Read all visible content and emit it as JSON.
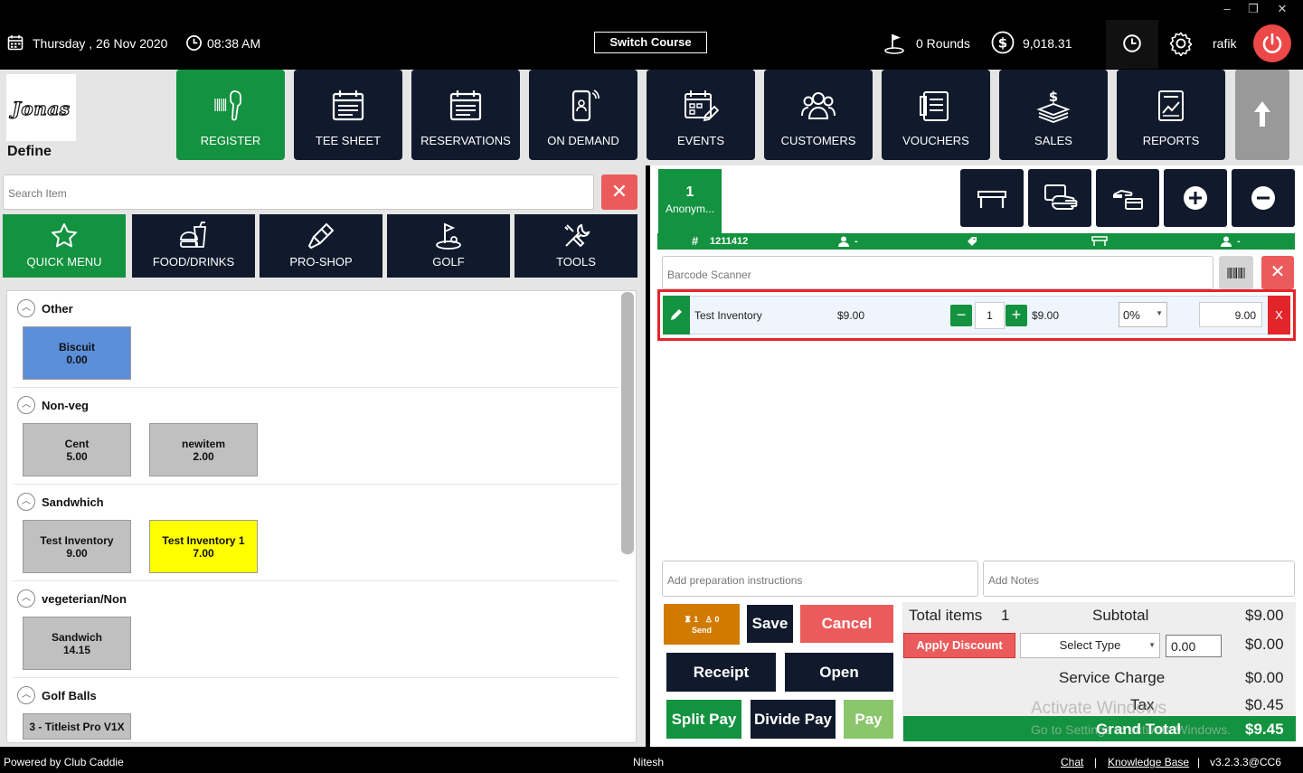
{
  "window_controls": {
    "minimize": "–",
    "restore": "❐",
    "close": "✕"
  },
  "topbar": {
    "date": "Thursday ,  26 Nov 2020",
    "time": "08:38 AM",
    "switch_course": "Switch Course",
    "rounds": "0 Rounds",
    "balance": "9,018.31",
    "user": "rafik"
  },
  "logo": {
    "text": "Jonas",
    "define": "Define"
  },
  "nav": [
    {
      "label": "REGISTER",
      "icon": "barcode-scanner-icon"
    },
    {
      "label": "TEE SHEET",
      "icon": "calendar-icon"
    },
    {
      "label": "RESERVATIONS",
      "icon": "calendar-icon"
    },
    {
      "label": "ON DEMAND",
      "icon": "mobile-icon"
    },
    {
      "label": "EVENTS",
      "icon": "calendar-edit-icon"
    },
    {
      "label": "CUSTOMERS",
      "icon": "users-icon"
    },
    {
      "label": "VOUCHERS",
      "icon": "voucher-icon"
    },
    {
      "label": "SALES",
      "icon": "cash-icon"
    },
    {
      "label": "REPORTS",
      "icon": "report-icon"
    }
  ],
  "search": {
    "placeholder": "Search Item"
  },
  "categories": [
    {
      "label": "QUICK MENU"
    },
    {
      "label": "FOOD/DRINKS"
    },
    {
      "label": "PRO-SHOP"
    },
    {
      "label": "GOLF"
    },
    {
      "label": "TOOLS"
    }
  ],
  "groups": [
    {
      "name": "Other",
      "items": [
        {
          "name": "Biscuit",
          "price": "0.00",
          "color": "#5b8fd9"
        }
      ]
    },
    {
      "name": "Non-veg",
      "items": [
        {
          "name": "Cent",
          "price": "5.00",
          "color": "#c0c0c0"
        },
        {
          "name": "newitem",
          "price": "2.00",
          "color": "#c0c0c0"
        }
      ]
    },
    {
      "name": "Sandwhich",
      "items": [
        {
          "name": "Test Inventory",
          "price": "9.00",
          "color": "#c0c0c0"
        },
        {
          "name": "Test Inventory 1",
          "price": "7.00",
          "color": "#ffff00"
        }
      ]
    },
    {
      "name": "vegeterian/Non",
      "items": [
        {
          "name": "Sandwich",
          "price": "14.15",
          "color": "#c0c0c0"
        }
      ]
    },
    {
      "name": "Golf Balls",
      "items": [
        {
          "name": "3 - Titleist Pro V1X",
          "price": "",
          "color": "#c0c0c0"
        }
      ]
    }
  ],
  "order": {
    "tab_number": "1",
    "tab_name": "Anonym...",
    "ticket": "1211412",
    "player": "-",
    "tag": "",
    "table": "",
    "server": "-",
    "barcode_placeholder": "Barcode Scanner",
    "line": {
      "name": "Test Inventory",
      "price": "$9.00",
      "qty": "1",
      "total": "$9.00",
      "discount": "0%",
      "amount": "9.00",
      "remove": "X"
    },
    "prep_placeholder": "Add preparation instructions",
    "notes_placeholder": "Add Notes"
  },
  "actions": {
    "send_seat": "1",
    "send_guests": "0",
    "send": "Send",
    "save": "Save",
    "cancel": "Cancel",
    "receipt": "Receipt",
    "open": "Open",
    "split_pay": "Split Pay",
    "divide_pay": "Divide Pay",
    "pay": "Pay"
  },
  "totals": {
    "items_label": "Total items",
    "items_count": "1",
    "subtotal_label": "Subtotal",
    "subtotal": "$9.00",
    "apply_discount": "Apply Discount",
    "select_type": "Select Type",
    "discount_value": "0.00",
    "discount_amount": "$0.00",
    "service_label": "Service Charge",
    "service": "$0.00",
    "tax_label": "Tax",
    "tax": "$0.45",
    "grand_label": "Grand Total",
    "grand": "$9.45"
  },
  "watermark": {
    "line1": "Activate Windows",
    "line2": "Go to Settings to activate Windows."
  },
  "footer": {
    "powered": "Powered by Club Caddie",
    "user": "Nitesh",
    "chat": "Chat",
    "kb": "Knowledge Base",
    "sep": "|",
    "version": "v3.2.3.3@CC6"
  },
  "colors": {
    "green": "#13923f",
    "navy": "#111a2c",
    "red": "#ec5b5b",
    "orange": "#d17a00",
    "highlight": "#e3242b"
  }
}
